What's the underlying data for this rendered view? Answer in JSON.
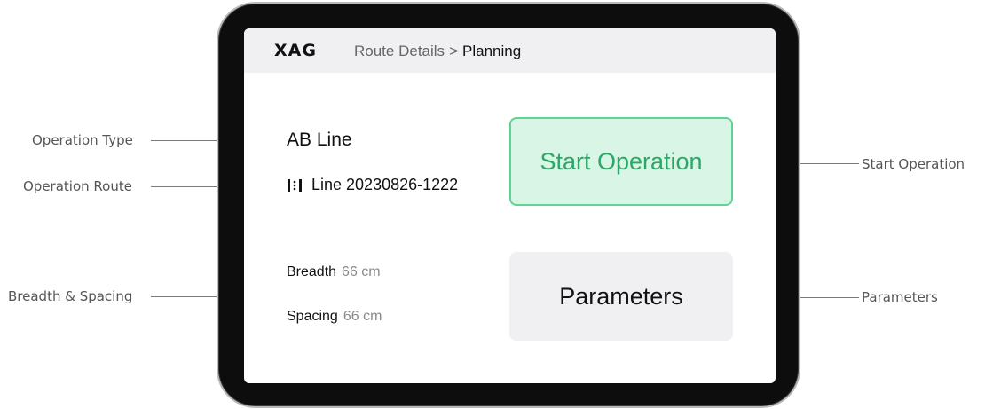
{
  "app": {
    "logo": "XAG",
    "breadcrumb": {
      "parent": "Route Details",
      "separator": ">",
      "current": "Planning"
    }
  },
  "operation": {
    "type": "AB Line",
    "route_name": "Line 20230826-1222",
    "route_icon": "ab-line-route-icon"
  },
  "params": {
    "breadth": {
      "label": "Breadth",
      "value": "66 cm"
    },
    "spacing": {
      "label": "Spacing",
      "value": "66 cm"
    }
  },
  "buttons": {
    "start": "Start Operation",
    "parameters": "Parameters"
  },
  "annotations": {
    "operation_type": "Operation Type",
    "operation_route": "Operation Route",
    "breadth_spacing": "Breadth & Spacing",
    "start_operation": "Start Operation",
    "parameters": "Parameters"
  },
  "colors": {
    "start_fill": "#d9f5e5",
    "start_border": "#5fd394",
    "start_text": "#2ba766",
    "panel_gray": "#f0f0f2"
  }
}
